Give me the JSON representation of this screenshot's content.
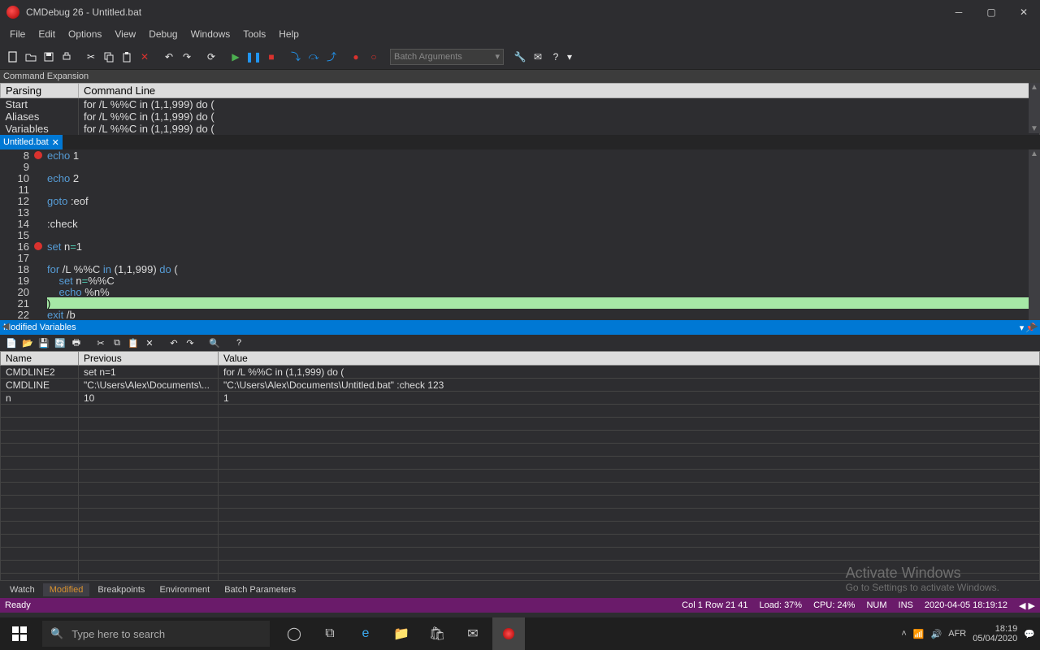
{
  "titlebar": {
    "title": "CMDebug 26 - Untitled.bat"
  },
  "menu": [
    "File",
    "Edit",
    "Options",
    "View",
    "Debug",
    "Windows",
    "Tools",
    "Help"
  ],
  "toolbar": {
    "batch_args_placeholder": "Batch Arguments"
  },
  "command_expansion": {
    "panel_title": "Command Expansion",
    "headers": [
      "Parsing",
      "Command Line"
    ],
    "rows": [
      {
        "label": "Start",
        "value": "for /L %%C in (1,1,999) do ("
      },
      {
        "label": "Aliases",
        "value": "for /L %%C in (1,1,999) do ("
      },
      {
        "label": "Variables",
        "value": "for /L %%C in (1,1,999) do ("
      }
    ]
  },
  "tab": {
    "name": "Untitled.bat",
    "close": "✕"
  },
  "editor": {
    "lines": [
      {
        "n": 8,
        "bp": true,
        "html": "<span class='kw-blue'>echo</span> <span class='kw-text'>1</span>"
      },
      {
        "n": 9,
        "bp": false,
        "html": ""
      },
      {
        "n": 10,
        "bp": false,
        "html": "<span class='kw-blue'>echo</span> <span class='kw-text'>2</span>"
      },
      {
        "n": 11,
        "bp": false,
        "html": ""
      },
      {
        "n": 12,
        "bp": false,
        "html": "<span class='kw-blue'>goto</span> <span class='kw-text'>:eof</span>"
      },
      {
        "n": 13,
        "bp": false,
        "html": ""
      },
      {
        "n": 14,
        "bp": false,
        "html": "<span class='kw-text'>:check</span>"
      },
      {
        "n": 15,
        "bp": false,
        "html": ""
      },
      {
        "n": 16,
        "bp": true,
        "html": "<span class='kw-blue'>set</span> <span class='kw-text'>n</span><span class='kw-cyan'>=</span><span class='kw-text'>1</span>"
      },
      {
        "n": 17,
        "bp": false,
        "html": ""
      },
      {
        "n": 18,
        "bp": false,
        "html": "<span class='kw-blue'>for</span> <span class='kw-text'>/L %%C </span><span class='kw-blue'>in</span><span class='kw-text'> (1,1,999) </span><span class='kw-blue'>do</span><span class='kw-text'> (</span>"
      },
      {
        "n": 19,
        "bp": false,
        "html": "    <span class='kw-blue'>set</span> <span class='kw-text'>n</span><span class='kw-cyan'>=</span><span class='kw-text'>%%C</span>"
      },
      {
        "n": 20,
        "bp": false,
        "html": "    <span class='kw-blue'>echo</span> <span class='kw-text'>%n%</span>"
      },
      {
        "n": 21,
        "bp": false,
        "highlight": true,
        "text": ")"
      },
      {
        "n": 22,
        "bp": false,
        "html": "<span class='kw-blue'>exit</span> <span class='kw-text'>/b</span>"
      }
    ]
  },
  "modified_variables": {
    "title": "Modified Variables",
    "headers": [
      "Name",
      "Previous",
      "Value"
    ],
    "rows": [
      {
        "name": "CMDLINE2",
        "previous": "set n=1",
        "value": "for /L %%C in (1,1,999) do ("
      },
      {
        "name": "CMDLINE",
        "previous": "\"C:\\Users\\Alex\\Documents\\...",
        "value": "\"C:\\Users\\Alex\\Documents\\Untitled.bat\" :check 123"
      },
      {
        "name": "n",
        "previous": "10",
        "value": "1"
      }
    ]
  },
  "bottom_tabs": [
    "Watch",
    "Modified",
    "Breakpoints",
    "Environment",
    "Batch Parameters"
  ],
  "status": {
    "ready": "Ready",
    "pos": "Col 1  Row 21   41",
    "load": "Load: 37%",
    "cpu": "CPU: 24%",
    "num": "NUM",
    "ins": "INS",
    "datetime": "2020-04-05   18:19:12"
  },
  "activate": {
    "big": "Activate Windows",
    "small": "Go to Settings to activate Windows."
  },
  "taskbar": {
    "search_placeholder": "Type here to search",
    "tray_lang": "AFR",
    "time": "18:19",
    "date": "05/04/2020"
  }
}
